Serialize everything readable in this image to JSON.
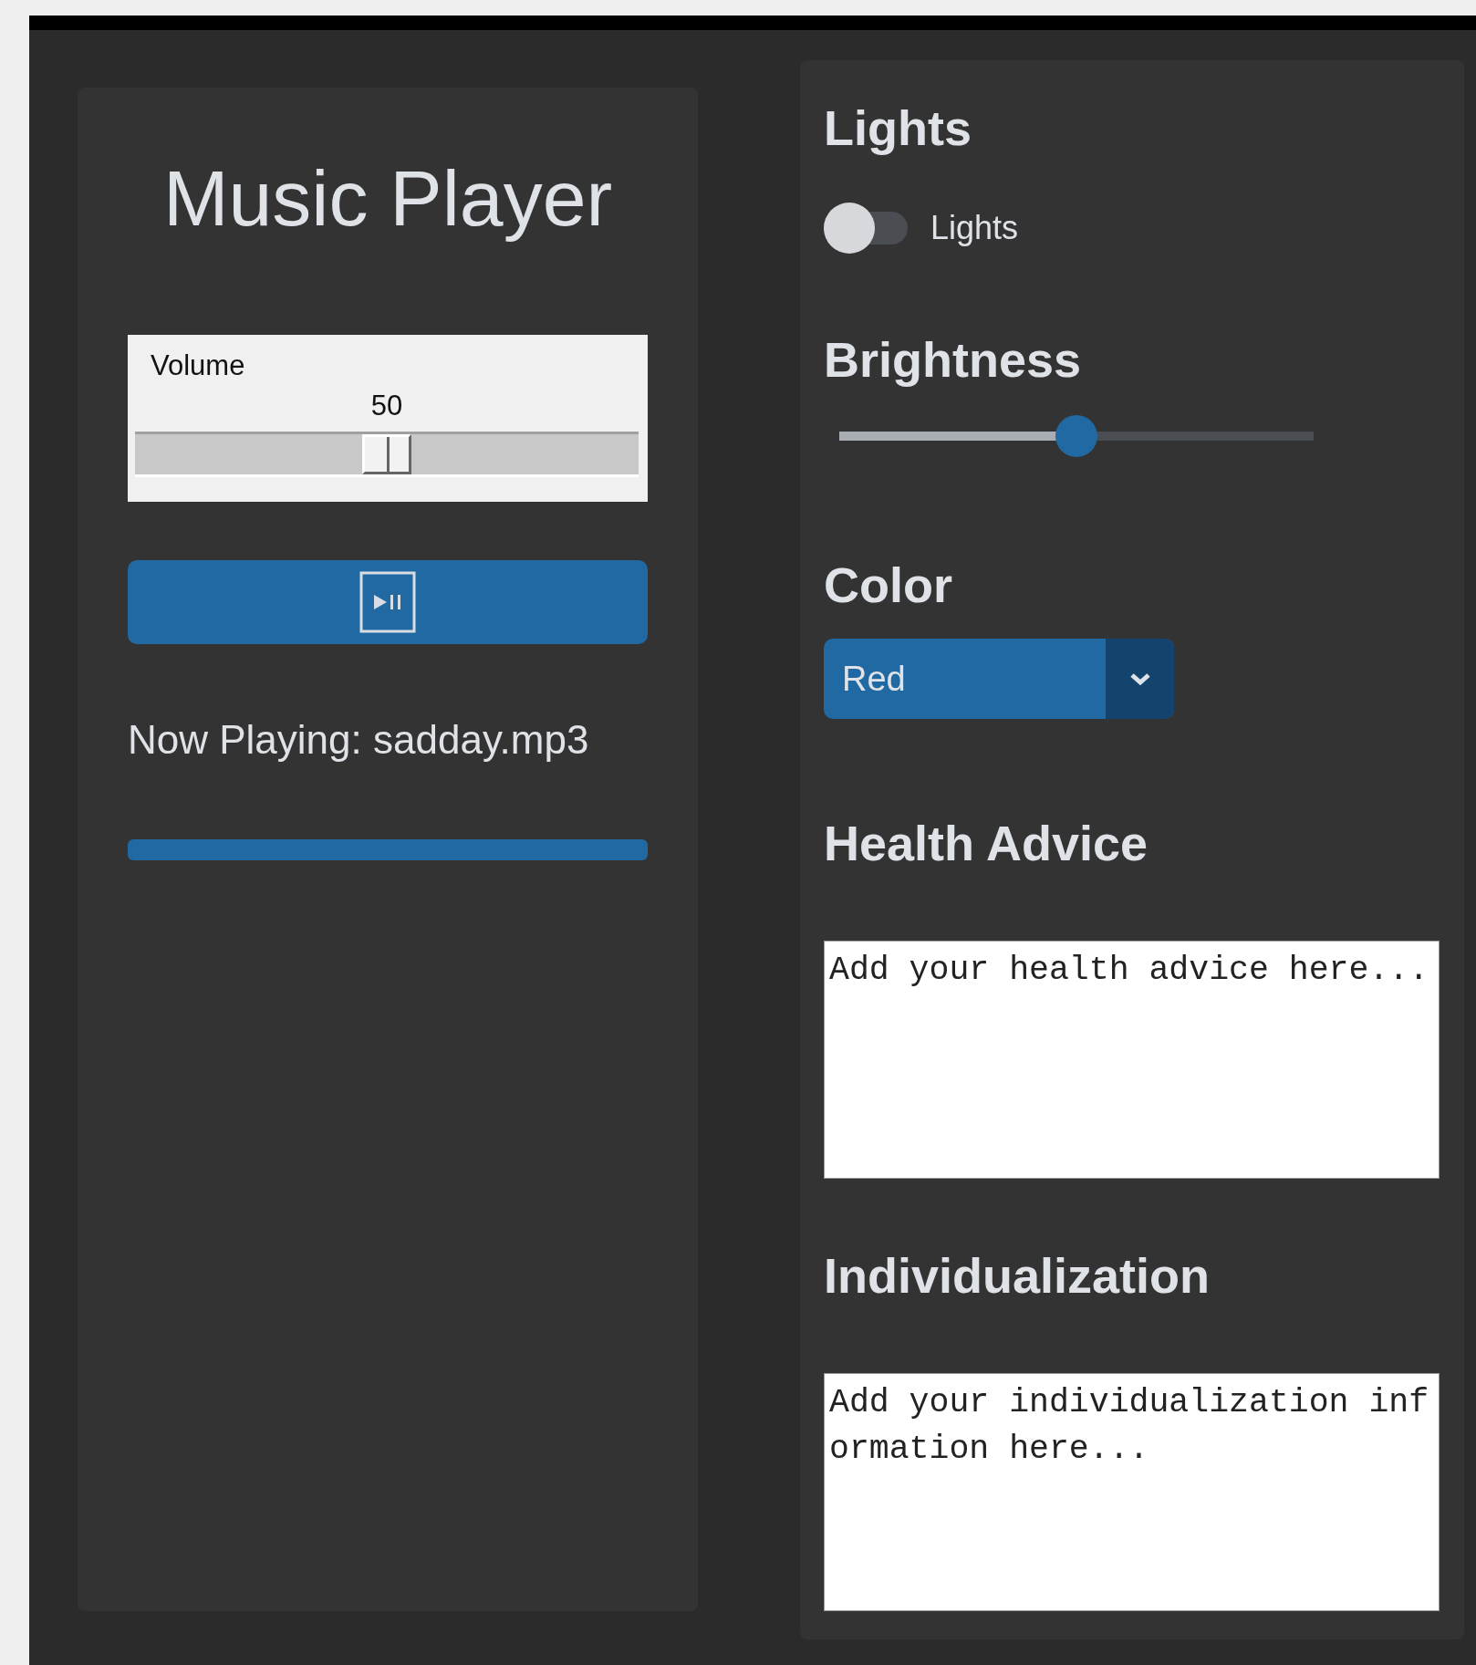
{
  "music_player": {
    "title": "Music Player",
    "volume": {
      "label": "Volume",
      "reading": "50",
      "level": 0.5
    },
    "now_playing": "Now Playing: sadday.mp3",
    "progress": {
      "level": 1
    }
  },
  "lights": {
    "heading": "Lights",
    "toggle": {
      "label": "Lights",
      "on": false
    }
  },
  "brightness": {
    "heading": "Brightness",
    "level": 0.5
  },
  "color": {
    "heading": "Color",
    "value": "Red"
  },
  "health_advice": {
    "heading": "Health Advice",
    "placeholder": "Add your health advice here..."
  },
  "individualization": {
    "heading": "Individualization",
    "placeholder": "Add your individualization information here..."
  }
}
